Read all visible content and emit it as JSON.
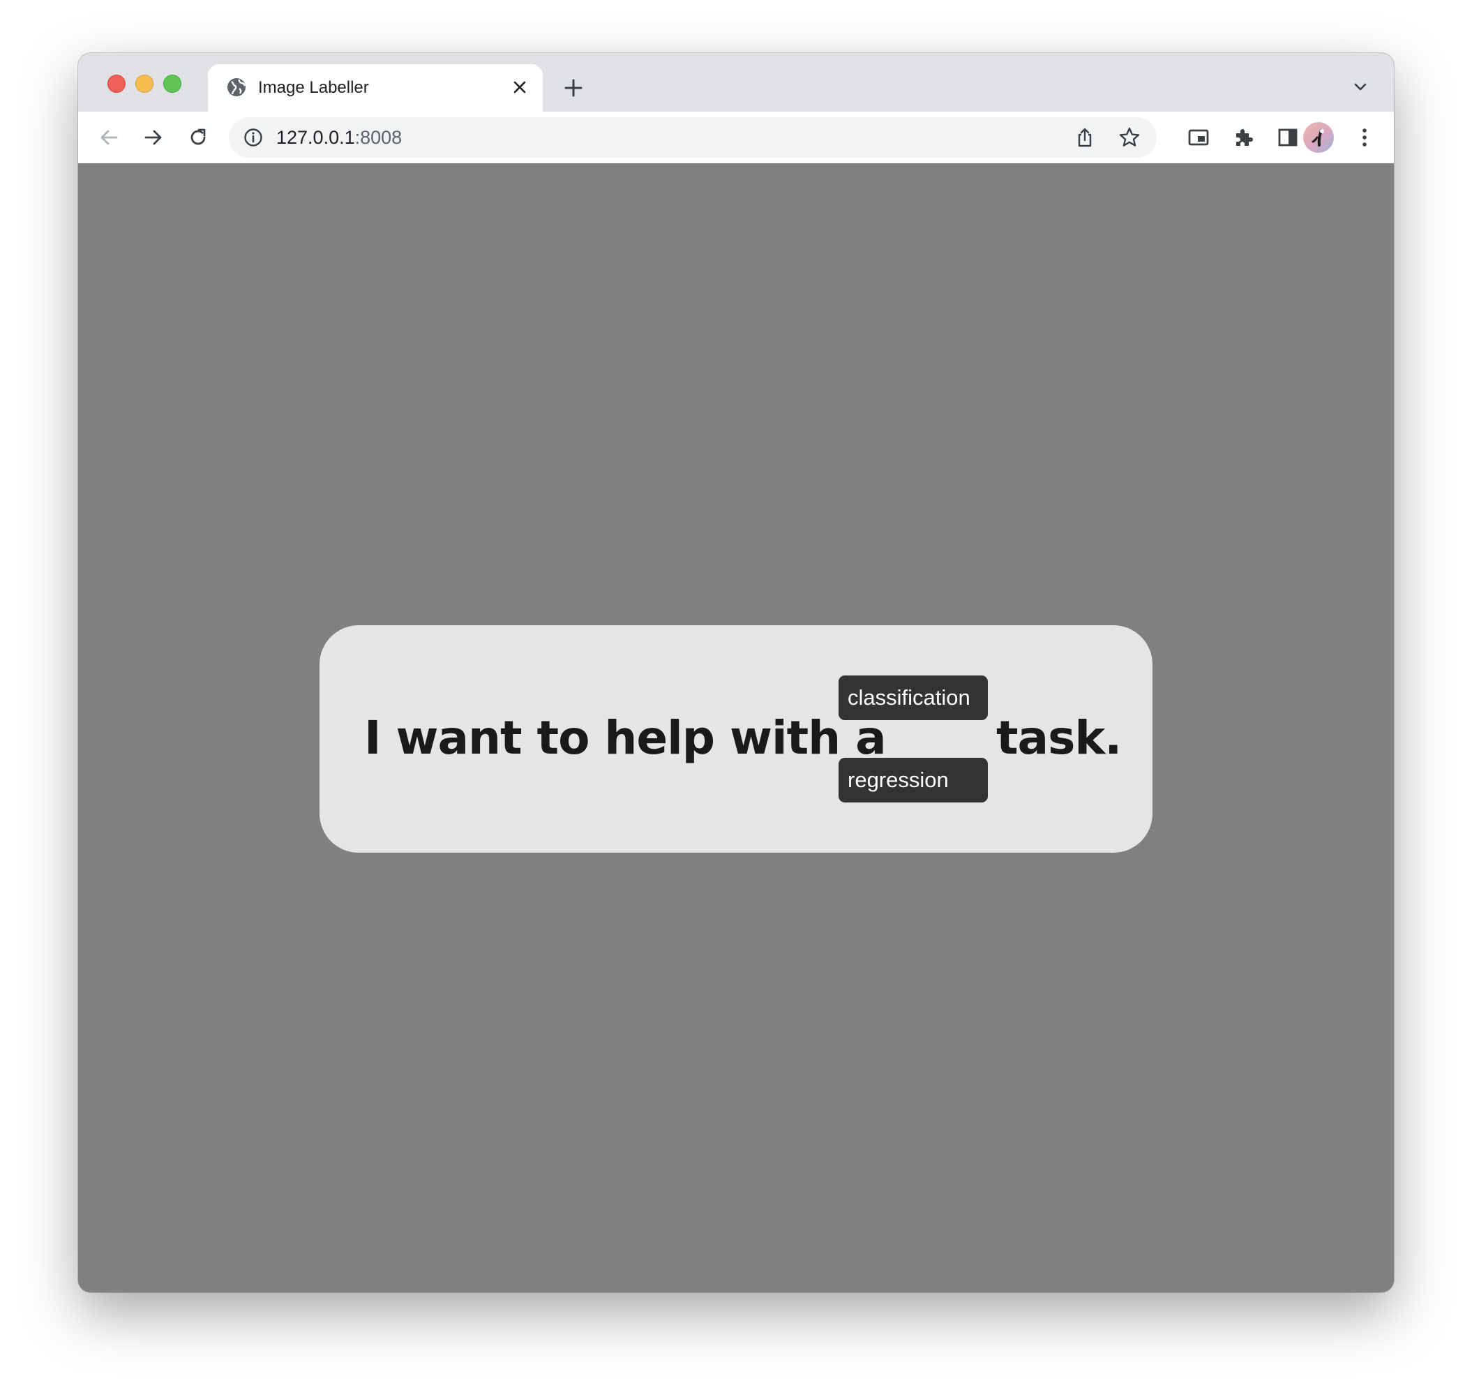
{
  "browser": {
    "tab": {
      "title": "Image Labeller",
      "icon": "globe-icon"
    },
    "address_bar": {
      "host": "127.0.0.1",
      "port": ":8008"
    },
    "icons": {
      "back": "arrow-left-icon",
      "forward": "arrow-right-icon",
      "reload": "reload-icon",
      "info": "info-icon",
      "share": "share-icon",
      "bookmark": "star-icon",
      "picture_in_picture": "picture-in-picture-icon",
      "extensions": "puzzle-icon",
      "side_panel": "side-panel-icon",
      "menu": "kebab-menu-icon",
      "new_tab": "plus-icon",
      "close_tab": "close-icon",
      "tab_search": "chevron-down-icon"
    }
  },
  "page": {
    "background_color": "#808080",
    "card_color": "#e5e5e5",
    "sentence": {
      "prefix": "I want to help with a",
      "suffix": "task."
    },
    "task_options": [
      {
        "label": "classification"
      },
      {
        "label": "regression"
      }
    ],
    "option_color": "#333333"
  }
}
